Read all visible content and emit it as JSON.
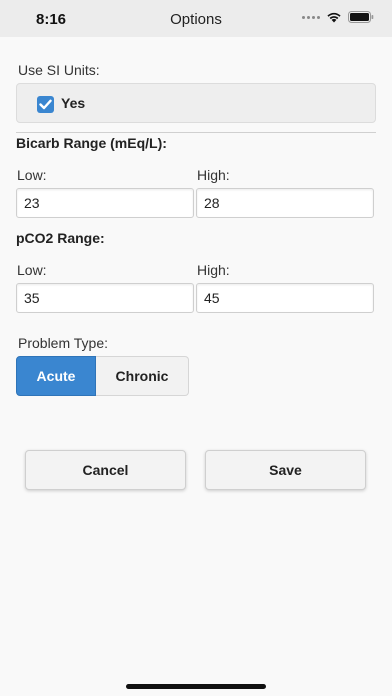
{
  "status_bar": {
    "time": "8:16"
  },
  "nav": {
    "title": "Options"
  },
  "si_units": {
    "label": "Use SI Units:",
    "option_label": "Yes",
    "checked": true
  },
  "bicarb": {
    "title": "Bicarb Range (mEq/L):",
    "low_label": "Low:",
    "low_value": "23",
    "high_label": "High:",
    "high_value": "28"
  },
  "pco2": {
    "title": "pCO2 Range:",
    "low_label": "Low:",
    "low_value": "35",
    "high_label": "High:",
    "high_value": "45"
  },
  "problem_type": {
    "label": "Problem Type:",
    "options": [
      "Acute",
      "Chronic"
    ],
    "selected": "Acute"
  },
  "actions": {
    "cancel_label": "Cancel",
    "save_label": "Save"
  },
  "colors": {
    "accent": "#3a86d0",
    "background": "#f9f9f9"
  }
}
